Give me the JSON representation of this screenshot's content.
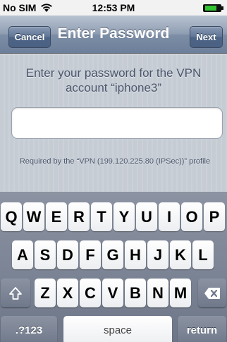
{
  "status_bar": {
    "carrier": "No SIM",
    "time": "12:53 PM"
  },
  "nav": {
    "title": "Enter Password",
    "cancel_label": "Cancel",
    "next_label": "Next"
  },
  "content": {
    "prompt": "Enter your password for the VPN account “iphone3”",
    "input_value": "",
    "footnote": "Required by the “VPN (199.120.225.80 (IPSec))” profile"
  },
  "keyboard": {
    "row1": [
      "Q",
      "W",
      "E",
      "R",
      "T",
      "Y",
      "U",
      "I",
      "O",
      "P"
    ],
    "row2": [
      "A",
      "S",
      "D",
      "F",
      "G",
      "H",
      "J",
      "K",
      "L"
    ],
    "row3": [
      "Z",
      "X",
      "C",
      "V",
      "B",
      "N",
      "M"
    ],
    "numbers_label": ".?123",
    "space_label": "space",
    "return_label": "return"
  }
}
